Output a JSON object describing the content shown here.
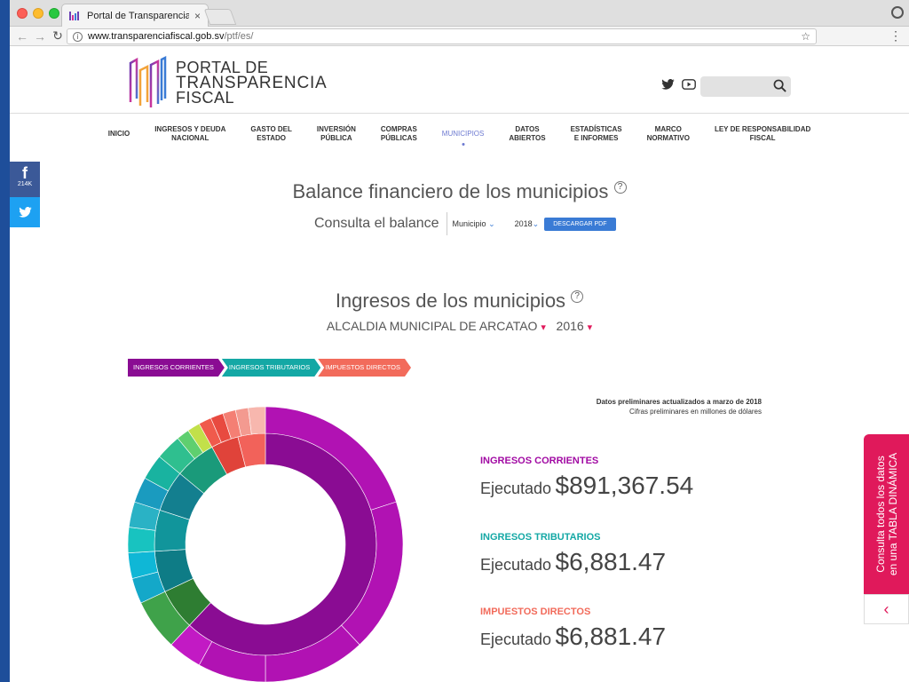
{
  "browser": {
    "tab_title": "Portal de Transparencia Fiscal",
    "url_host": "www.transparenciafiscal.gob.sv",
    "url_path": "/ptf/es/"
  },
  "header": {
    "logo_line1": "PORTAL DE",
    "logo_line2": "TRANSPARENCIA",
    "logo_line3": "FISCAL"
  },
  "nav": [
    {
      "line1": "INICIO",
      "line2": ""
    },
    {
      "line1": "INGRESOS Y DEUDA",
      "line2": "NACIONAL"
    },
    {
      "line1": "GASTO DEL",
      "line2": "ESTADO"
    },
    {
      "line1": "INVERSIÓN",
      "line2": "PÚBLICA"
    },
    {
      "line1": "COMPRAS",
      "line2": "PÚBLICAS"
    },
    {
      "line1": "MUNICIPIOS",
      "line2": ""
    },
    {
      "line1": "DATOS",
      "line2": "ABIERTOS"
    },
    {
      "line1": "ESTADÍSTICAS",
      "line2": "E INFORMES"
    },
    {
      "line1": "MARCO",
      "line2": "NORMATIVO"
    },
    {
      "line1": "LEY DE RESPONSABILIDAD",
      "line2": "FISCAL"
    }
  ],
  "share": {
    "fb_count": "214K"
  },
  "balance": {
    "title": "Balance financiero de los municipios",
    "consulta": "Consulta el balance",
    "municipio_select": "Municipio",
    "year_select": "2018",
    "download": "DESCARGAR PDF"
  },
  "ingresos": {
    "title": "Ingresos de los municipios",
    "alcaldia": "ALCALDIA MUNICIPAL DE ARCATAO",
    "year": "2016"
  },
  "breadcrumb": [
    {
      "label": "INGRESOS CORRIENTES",
      "color": "#8a0c93"
    },
    {
      "label": "INGRESOS TRIBUTARIOS",
      "color": "#14a8a5"
    },
    {
      "label": "IMPUESTOS DIRECTOS",
      "color": "#f26b5b"
    }
  ],
  "prelim": {
    "line1": "Datos preliminares actualizados a marzo de 2018",
    "line2": "Cifras preliminares en millones de dólares"
  },
  "stats": [
    {
      "label": "INGRESOS CORRIENTES",
      "prefix": "Ejecutado",
      "value": "$891,367.54",
      "color": "#a10aa3"
    },
    {
      "label": "INGRESOS TRIBUTARIOS",
      "prefix": "Ejecutado",
      "value": "$6,881.47",
      "color": "#14a8a5"
    },
    {
      "label": "IMPUESTOS DIRECTOS",
      "prefix": "Ejecutado",
      "value": "$6,881.47",
      "color": "#f26b5b"
    }
  ],
  "tabla_tab": {
    "line1": "Consulta todos los datos",
    "line2": "en una TABLA DINÁMICA"
  },
  "colors": {
    "magenta": "#a10aa3",
    "teal": "#14a8a5",
    "coral": "#f26b5b",
    "pink": "#e0195b",
    "blue": "#3a7bd5"
  }
}
